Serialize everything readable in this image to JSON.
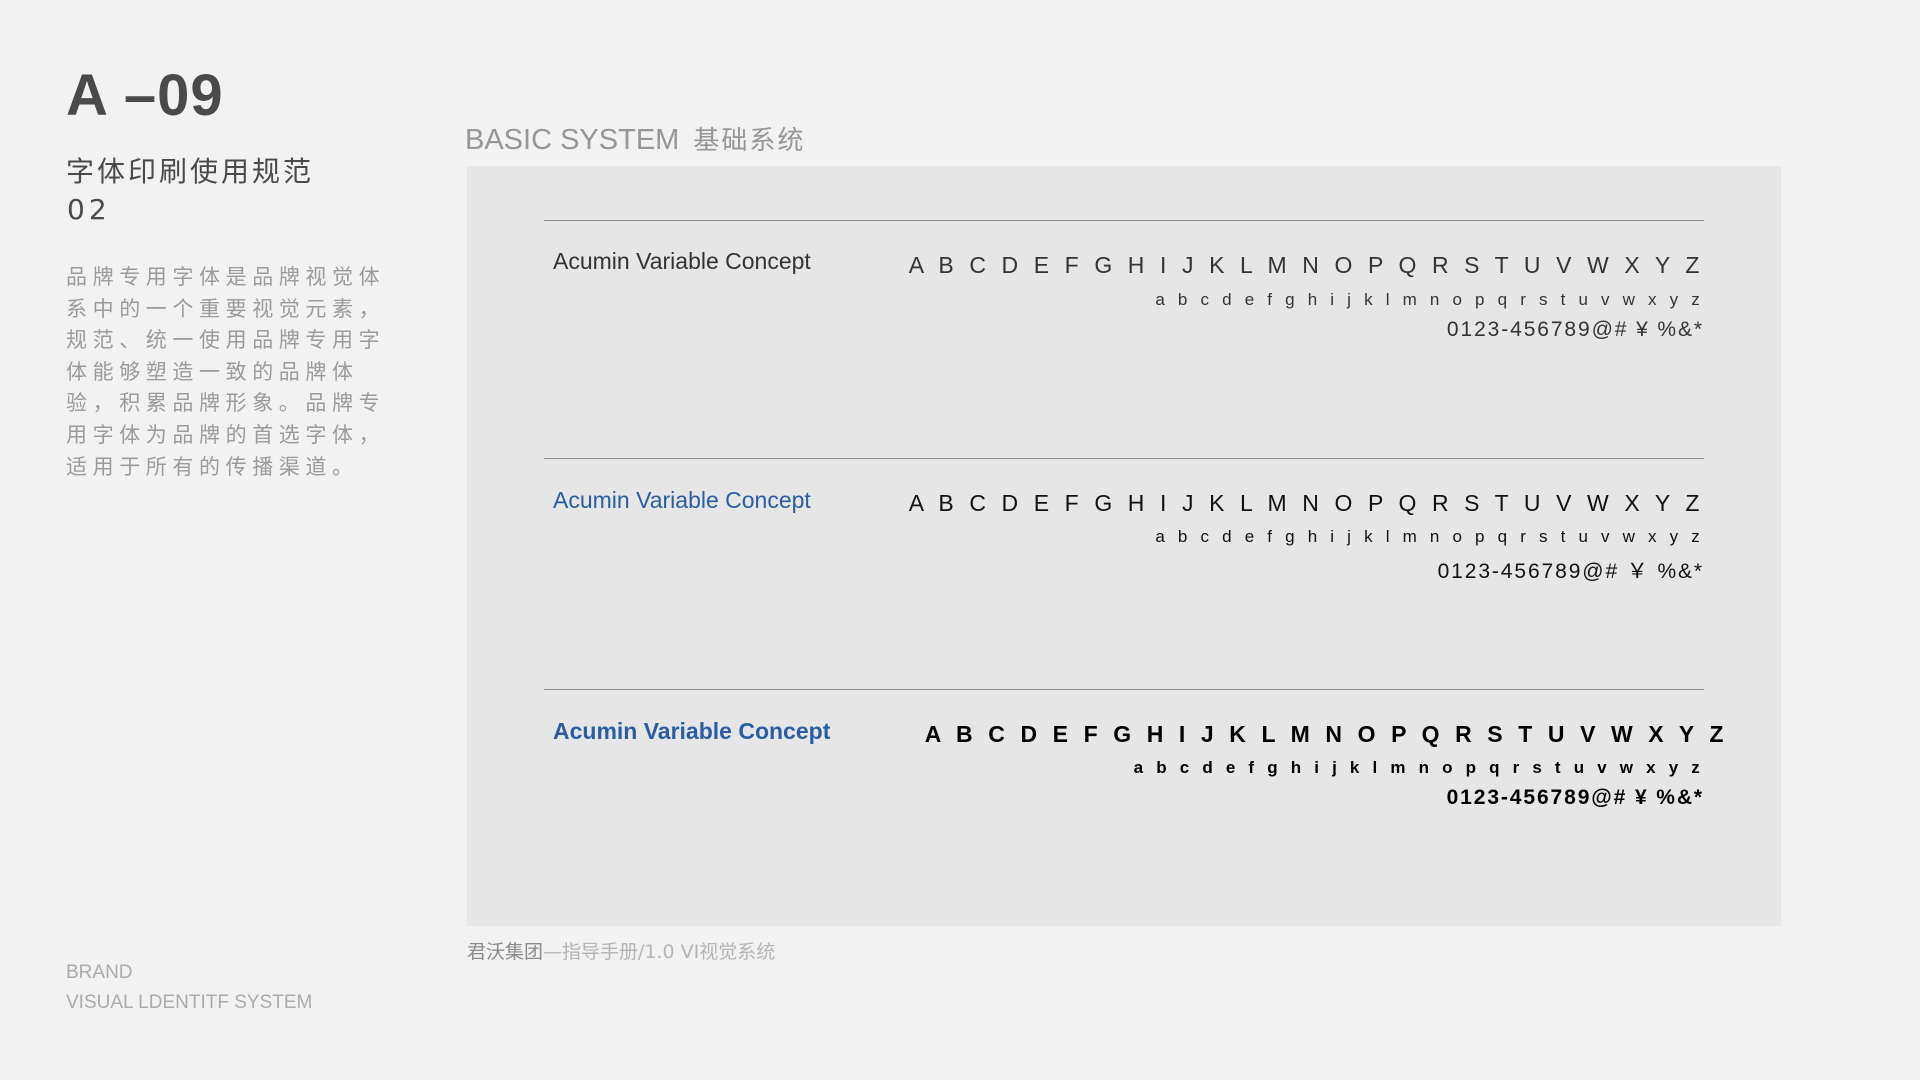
{
  "page": {
    "code": "A –09",
    "subtitle": "字体印刷使用规范",
    "subtitle_number": "02",
    "description": "品牌专用字体是品牌视觉体系中的一个重要视觉元素，规范、统一使用品牌专用字体能够塑造一致的品牌体验，积累品牌形象。品牌专用字体为品牌的首选字体，适用于所有的传播渠道。",
    "brand_line1": "BRAND",
    "brand_line2": "VISUAL LDENTITF SYSTEM"
  },
  "section": {
    "title_en": "BASIC SYSTEM",
    "title_cn": "基础系统"
  },
  "font_samples": [
    {
      "name": "Acumin Variable Concept",
      "weight": "light",
      "uppercase": "A B C D E F G H I J K L M N O P Q R S T U V W X Y Z",
      "lowercase": "a b c d e f g h i j k l m n o p q r s t u v w x y z",
      "numbers": "0123-456789@# ¥ %&*"
    },
    {
      "name": "Acumin Variable Concept",
      "weight": "regular",
      "uppercase": "A B C D E F G H I J K L M N O P Q R S T U V W X Y Z",
      "lowercase": "a b c d e f g h i j k l m n o p q r s t u v w x y z",
      "numbers": "0123-456789@# ￥ %&*"
    },
    {
      "name": "Acumin Variable Concept",
      "weight": "bold",
      "uppercase": "A B C D E F G H I J K L M N O P Q R S T U V W X Y Z",
      "lowercase": "a b c d e f g h i j k l m n o p q r s t u v w x y z",
      "numbers": "0123-456789@# ¥ %&*"
    }
  ],
  "footer": {
    "company": "君沃集团",
    "rest": "—指导手册/1.0  VI视觉系统"
  },
  "colors": {
    "background": "#f2f2f2",
    "panel": "#e6e6e6",
    "accent_blue": "#2a5da1",
    "heading_gray": "#4a4a4a"
  }
}
